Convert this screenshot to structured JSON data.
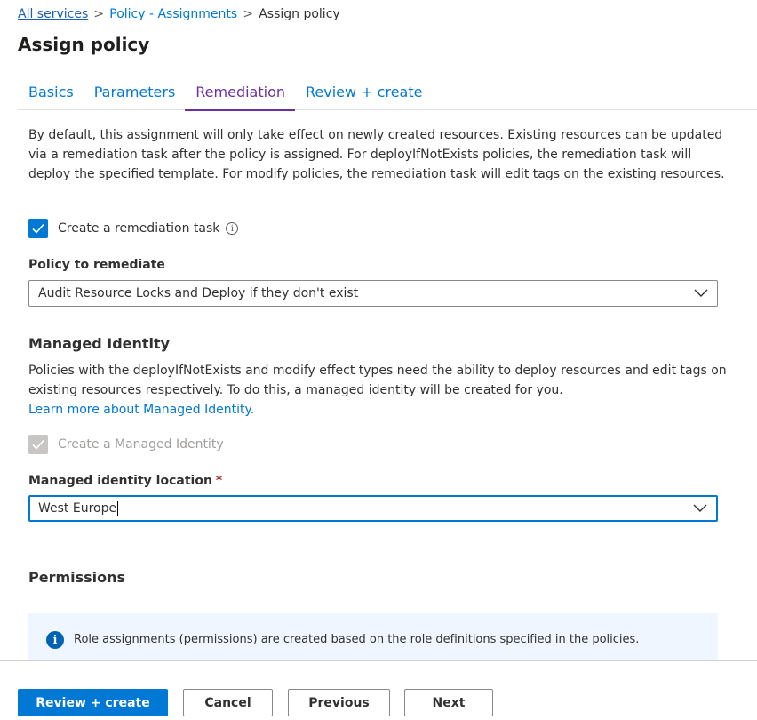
{
  "breadcrumb": {
    "items": [
      "All services",
      "Policy - Assignments"
    ],
    "current": "Assign policy",
    "separator": ">"
  },
  "page": {
    "title": "Assign policy"
  },
  "tabs": [
    {
      "label": "Basics"
    },
    {
      "label": "Parameters"
    },
    {
      "label": "Remediation"
    },
    {
      "label": "Review + create"
    }
  ],
  "active_tab": "Remediation",
  "remediation": {
    "description": "By default, this assignment will only take effect on newly created resources. Existing resources can be updated via a remediation task after the policy is assigned. For deployIfNotExists policies, the remediation task will deploy the specified template. For modify policies, the remediation task will edit tags on the existing resources.",
    "create_task_label": "Create a remediation task",
    "create_task_checked": true,
    "policy_label": "Policy to remediate",
    "policy_value": "Audit Resource Locks and Deploy if they don't exist"
  },
  "managed_identity": {
    "title": "Managed Identity",
    "description": "Policies with the deployIfNotExists and modify effect types need the ability to deploy resources and edit tags on existing resources respectively. To do this, a managed identity will be created for you.",
    "learn_more": "Learn more about Managed Identity.",
    "create_label": "Create a Managed Identity",
    "create_checked": true,
    "create_disabled": true,
    "location_label": "Managed identity location",
    "required_marker": "*",
    "location_value": "West Europe"
  },
  "permissions": {
    "title": "Permissions",
    "info_text": "Role assignments (permissions) are created based on the role definitions specified in the policies."
  },
  "footer": {
    "review_create": "Review + create",
    "cancel": "Cancel",
    "previous": "Previous",
    "next": "Next"
  },
  "colors": {
    "accent": "#0078d4",
    "active_tab": "#6b2fa0",
    "info_bg": "#f0f6ff",
    "required": "#a4262c"
  }
}
